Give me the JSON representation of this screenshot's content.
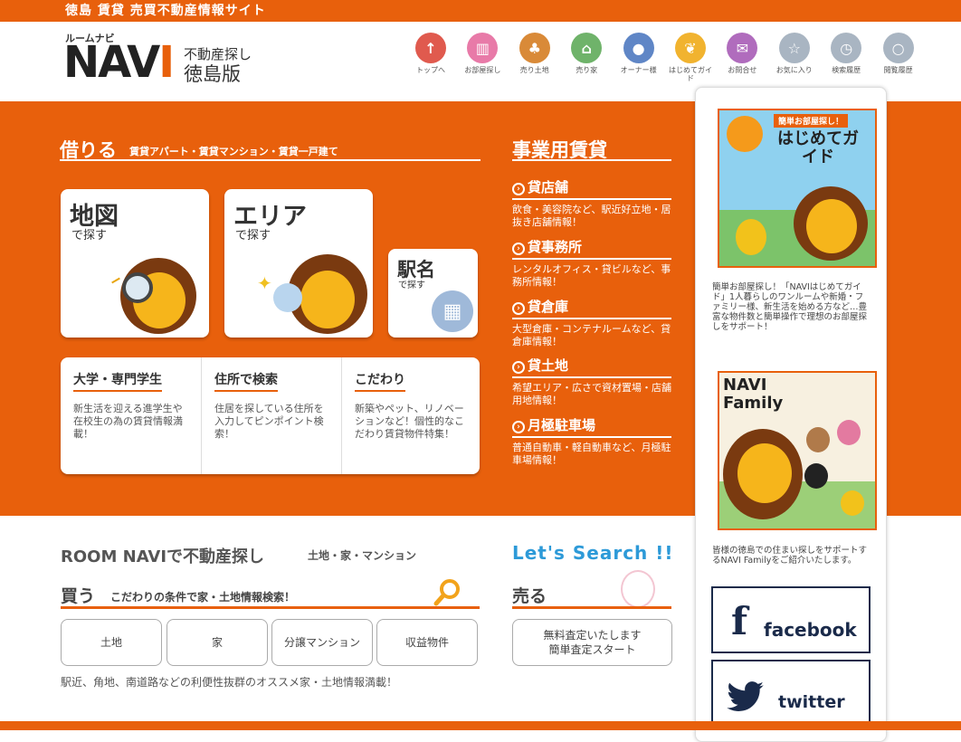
{
  "site": {
    "topbar": "徳島 賃貸 売買不動産情報サイト",
    "logo_small": "ルームナビ",
    "logo_main_a": "NAV",
    "logo_main_b": "I",
    "logo_sub1": "不動産探し",
    "logo_sub2": "徳島版"
  },
  "nav": [
    {
      "label": "トップへ",
      "color": "#e05a4e",
      "icon": "arrow-up-icon"
    },
    {
      "label": "お部屋探し",
      "color": "#e87aa8",
      "icon": "building-icon"
    },
    {
      "label": "売り土地",
      "color": "#d98a38",
      "icon": "tree-icon"
    },
    {
      "label": "売り家",
      "color": "#6fb36a",
      "icon": "house-icon"
    },
    {
      "label": "オーナー様",
      "color": "#5f86c6",
      "icon": "person-icon"
    },
    {
      "label": "はじめてガイド",
      "color": "#f1b32f",
      "icon": "leaf-icon"
    },
    {
      "label": "お問合せ",
      "color": "#b06cbd",
      "icon": "mail-icon"
    },
    {
      "label": "お気に入り",
      "color": "#a9b5c2",
      "icon": "star-icon"
    },
    {
      "label": "検索履歴",
      "color": "#a9b5c2",
      "icon": "clock-icon"
    },
    {
      "label": "閲覧履歴",
      "color": "#a9b5c2",
      "icon": "search-icon"
    }
  ],
  "rent": {
    "title": "借りる",
    "subtitle": "賃貸アパート・賃貸マンション・賃貸一戸建て",
    "map_title": "地図",
    "map_sub": "で探す",
    "area_title": "エリア",
    "area_sub": "で探す",
    "station_title": "駅名",
    "station_sub": "で探す",
    "cols": [
      {
        "title": "大学・専門学生",
        "desc": "新生活を迎える進学生や在校生の為の賃貸情報満載！"
      },
      {
        "title": "住所で検索",
        "desc": "住居を探している住所を入力してピンポイント検索！"
      },
      {
        "title": "こだわり",
        "desc": "新築やペット、リノベーションなど！個性的なこだわり賃貸物件特集！"
      }
    ]
  },
  "biz": {
    "title": "事業用賃貸",
    "items": [
      {
        "title": "貸店舗",
        "desc": "飲食・美容院など、駅近好立地・居抜き店舗情報！"
      },
      {
        "title": "貸事務所",
        "desc": "レンタルオフィス・貸ビルなど、事務所情報！"
      },
      {
        "title": "貸倉庫",
        "desc": "大型倉庫・コンテナルームなど、貸倉庫情報！"
      },
      {
        "title": "貸土地",
        "desc": "希望エリア・広さで資材置場・店舗用地情報！"
      },
      {
        "title": "月極駐車場",
        "desc": "普通自動車・軽自動車など、月極駐車場情報！"
      }
    ]
  },
  "sidebar": {
    "guide_banner_top": "簡単お部屋探し！",
    "guide_banner_title": "はじめてガイド",
    "guide_text": "簡単お部屋探し！「NAVIはじめてガイド」1人暮らしのワンルームや新婚・ファミリー様、新生活を始める方など…豊富な物件数と簡単操作で理想のお部屋探しをサポート！",
    "family_banner_title": "NAVI Family",
    "family_text": "皆様の徳島での住まい探しをサポートするNAVI Familyをご紹介いたします。",
    "facebook": "facebook",
    "twitter": "twitter"
  },
  "buy": {
    "room_title": "ROOM NAVIで不動産探し",
    "room_sub": "土地・家・マンション",
    "title": "買う",
    "subtitle": "こだわりの条件で家・土地情報検索！",
    "buttons": [
      "土地",
      "家",
      "分譲マンション",
      "収益物件"
    ],
    "note": "駅近、角地、南道路などの利便性抜群のオススメ家・土地情報満載！"
  },
  "sell": {
    "lets": "Let's Search !!",
    "title": "売る",
    "button_line1": "無料査定いたします",
    "button_line2": "簡単査定スタート"
  }
}
